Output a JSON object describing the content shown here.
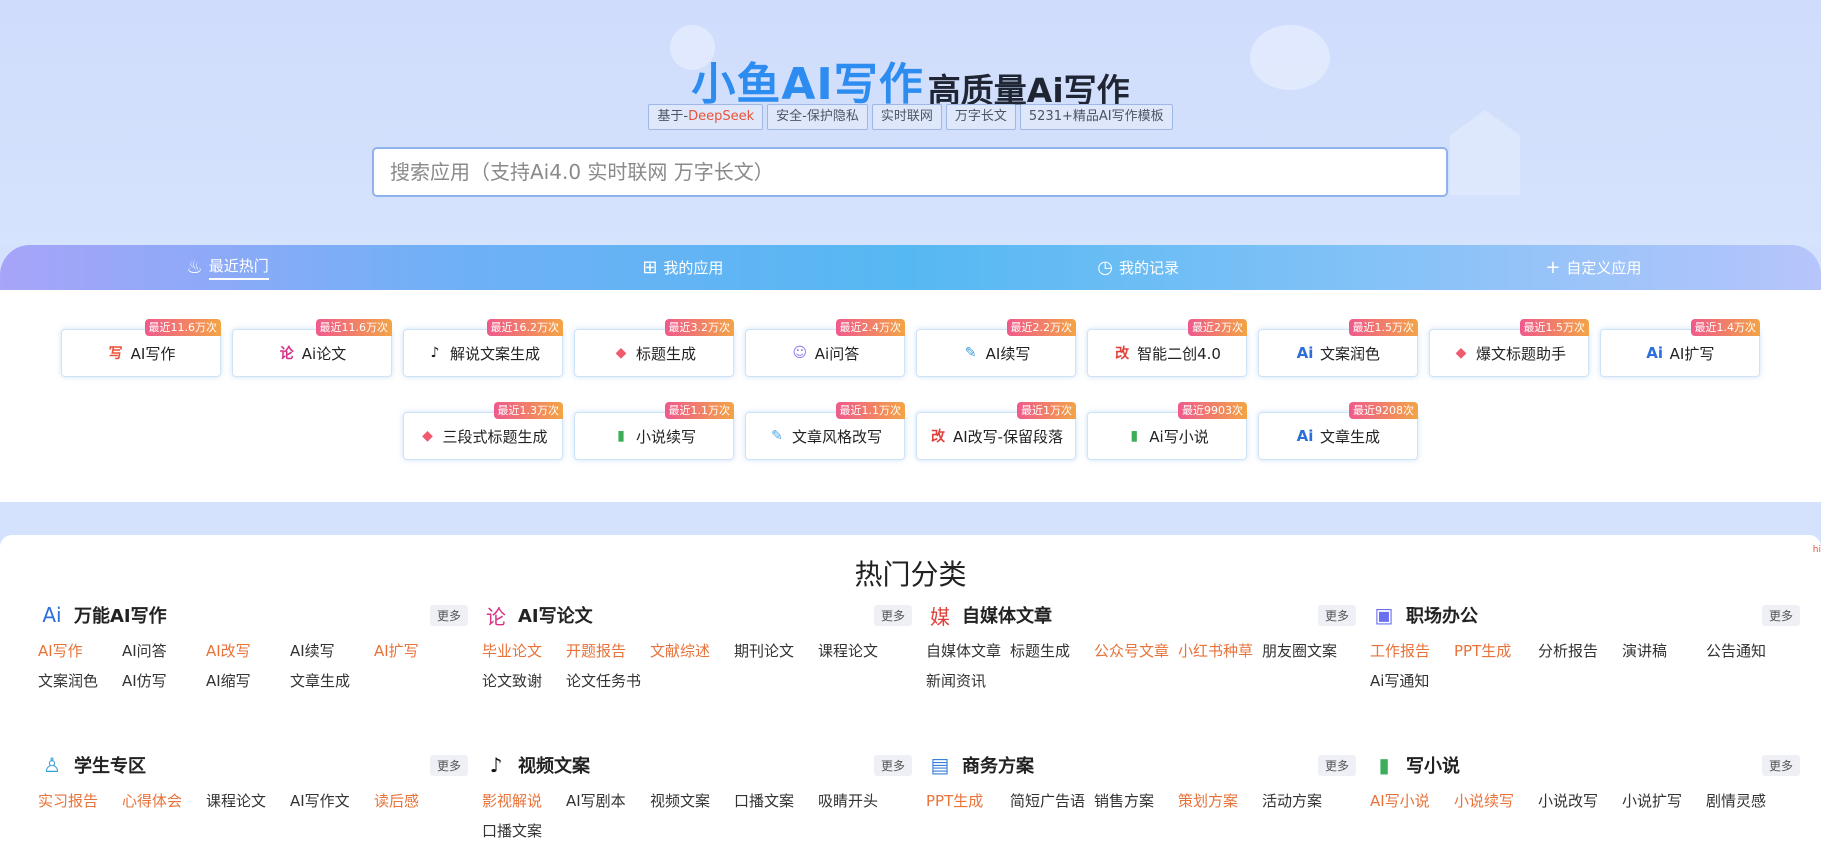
{
  "header": {
    "title_main": "小鱼AI写作",
    "title_sub": "高质量Ai写作",
    "tags": [
      {
        "prefix": "基于-",
        "highlight": "DeepSeek"
      },
      {
        "prefix": "安全-保护隐私",
        "highlight": ""
      },
      {
        "prefix": "实时联网",
        "highlight": ""
      },
      {
        "prefix": "万字长文",
        "highlight": ""
      },
      {
        "prefix": "5231+精品AI写作模板",
        "highlight": ""
      }
    ],
    "search_placeholder": "搜索应用（支持Ai4.0 实时联网 万字长文）"
  },
  "nav": {
    "tabs": [
      {
        "label": "最近热门",
        "icon": "flame-icon"
      },
      {
        "label": "我的应用",
        "icon": "grid-icon"
      },
      {
        "label": "我的记录",
        "icon": "clock-icon"
      },
      {
        "label": "自定义应用",
        "icon": "plus-icon"
      }
    ]
  },
  "hot_apps": [
    {
      "label": "AI写作",
      "badge": "最近11.6万次",
      "icon": "ai-write-icon",
      "color": "#e8533a"
    },
    {
      "label": "Ai论文",
      "badge": "最近11.6万次",
      "icon": "thesis-icon",
      "color": "#d63384"
    },
    {
      "label": "解说文案生成",
      "badge": "最近16.2万次",
      "icon": "tiktok-icon",
      "color": "#111111"
    },
    {
      "label": "标题生成",
      "badge": "最近3.2万次",
      "icon": "tag-icon",
      "color": "#f05a6e"
    },
    {
      "label": "Ai问答",
      "badge": "最近2.4万次",
      "icon": "robot-icon",
      "color": "#8a7cf0"
    },
    {
      "label": "AI续写",
      "badge": "最近2.2万次",
      "icon": "pen-icon",
      "color": "#3aa0d8"
    },
    {
      "label": "智能二创4.0",
      "badge": "最近2万次",
      "icon": "rewrite-icon",
      "color": "#e0413a"
    },
    {
      "label": "文案润色",
      "badge": "最近1.5万次",
      "icon": "ai-sparkle-icon",
      "color": "#2d6fd8"
    },
    {
      "label": "爆文标题助手",
      "badge": "最近1.5万次",
      "icon": "tag-icon",
      "color": "#f05a6e"
    },
    {
      "label": "AI扩写",
      "badge": "最近1.4万次",
      "icon": "ai-sparkle-icon",
      "color": "#2d6fd8"
    },
    {
      "label": "三段式标题生成",
      "badge": "最近1.3万次",
      "icon": "tag-icon",
      "color": "#f05a6e"
    },
    {
      "label": "小说续写",
      "badge": "最近1.1万次",
      "icon": "book-icon",
      "color": "#3cae5a"
    },
    {
      "label": "文章风格改写",
      "badge": "最近1.1万次",
      "icon": "edit-icon",
      "color": "#4aa8e8"
    },
    {
      "label": "AI改写-保留段落",
      "badge": "最近1万次",
      "icon": "rewrite-icon",
      "color": "#e0413a"
    },
    {
      "label": "Ai写小说",
      "badge": "最近9903次",
      "icon": "book-icon",
      "color": "#3cae5a"
    },
    {
      "label": "文章生成",
      "badge": "最近9208次",
      "icon": "ai-sparkle-icon",
      "color": "#2d6fd8"
    }
  ],
  "categories_title": "热门分类",
  "more_label": "更多",
  "categories": [
    {
      "name": "万能AI写作",
      "icon": "ai-sparkle-icon",
      "glyph": "Ai",
      "color": "#2d6fd8",
      "links": [
        {
          "t": "AI写作",
          "hot": true
        },
        {
          "t": "AI问答",
          "hot": false
        },
        {
          "t": "AI改写",
          "hot": true
        },
        {
          "t": "AI续写",
          "hot": false
        },
        {
          "t": "AI扩写",
          "hot": true
        },
        {
          "t": "文案润色",
          "hot": false
        },
        {
          "t": "AI仿写",
          "hot": false
        },
        {
          "t": "AI缩写",
          "hot": false
        },
        {
          "t": "文章生成",
          "hot": false
        }
      ]
    },
    {
      "name": "AI写论文",
      "icon": "thesis-icon",
      "glyph": "论",
      "color": "#d63384",
      "links": [
        {
          "t": "毕业论文",
          "hot": true
        },
        {
          "t": "开题报告",
          "hot": true
        },
        {
          "t": "文献综述",
          "hot": true
        },
        {
          "t": "期刊论文",
          "hot": false
        },
        {
          "t": "课程论文",
          "hot": false
        },
        {
          "t": "论文致谢",
          "hot": false
        },
        {
          "t": "论文任务书",
          "hot": false
        }
      ]
    },
    {
      "name": "自媒体文章",
      "icon": "media-icon",
      "glyph": "媒",
      "color": "#e0413a",
      "links": [
        {
          "t": "自媒体文章",
          "hot": false
        },
        {
          "t": "标题生成",
          "hot": false
        },
        {
          "t": "公众号文章",
          "hot": true
        },
        {
          "t": "小红书种草",
          "hot": true
        },
        {
          "t": "朋友圈文案",
          "hot": false
        },
        {
          "t": "新闻资讯",
          "hot": false
        }
      ]
    },
    {
      "name": "职场办公",
      "icon": "briefcase-icon",
      "glyph": "▣",
      "color": "#6a6ff0",
      "links": [
        {
          "t": "工作报告",
          "hot": true
        },
        {
          "t": "PPT生成",
          "hot": true
        },
        {
          "t": "分析报告",
          "hot": false
        },
        {
          "t": "演讲稿",
          "hot": false
        },
        {
          "t": "公告通知",
          "hot": false
        },
        {
          "t": "Ai写通知",
          "hot": false
        }
      ]
    },
    {
      "name": "学生专区",
      "icon": "student-icon",
      "glyph": "♙",
      "color": "#3aa0d8",
      "links": [
        {
          "t": "实习报告",
          "hot": true
        },
        {
          "t": "心得体会",
          "hot": true
        },
        {
          "t": "课程论文",
          "hot": false
        },
        {
          "t": "AI写作文",
          "hot": false
        },
        {
          "t": "读后感",
          "hot": true
        }
      ]
    },
    {
      "name": "视频文案",
      "icon": "tiktok-icon",
      "glyph": "♪",
      "color": "#111111",
      "links": [
        {
          "t": "影视解说",
          "hot": true
        },
        {
          "t": "AI写剧本",
          "hot": false
        },
        {
          "t": "视频文案",
          "hot": false
        },
        {
          "t": "口播文案",
          "hot": false
        },
        {
          "t": "吸睛开头",
          "hot": false
        },
        {
          "t": "口播文案",
          "hot": false
        }
      ]
    },
    {
      "name": "商务方案",
      "icon": "business-icon",
      "glyph": "▤",
      "color": "#3a7fd8",
      "links": [
        {
          "t": "PPT生成",
          "hot": true
        },
        {
          "t": "简短广告语",
          "hot": false
        },
        {
          "t": "销售方案",
          "hot": false
        },
        {
          "t": "策划方案",
          "hot": true
        },
        {
          "t": "活动方案",
          "hot": false
        }
      ]
    },
    {
      "name": "写小说",
      "icon": "book-icon",
      "glyph": "▮",
      "color": "#3cae5a",
      "links": [
        {
          "t": "AI写小说",
          "hot": true
        },
        {
          "t": "小说续写",
          "hot": true
        },
        {
          "t": "小说改写",
          "hot": false
        },
        {
          "t": "小说扩写",
          "hot": false
        },
        {
          "t": "剧情灵感",
          "hot": false
        }
      ]
    }
  ]
}
